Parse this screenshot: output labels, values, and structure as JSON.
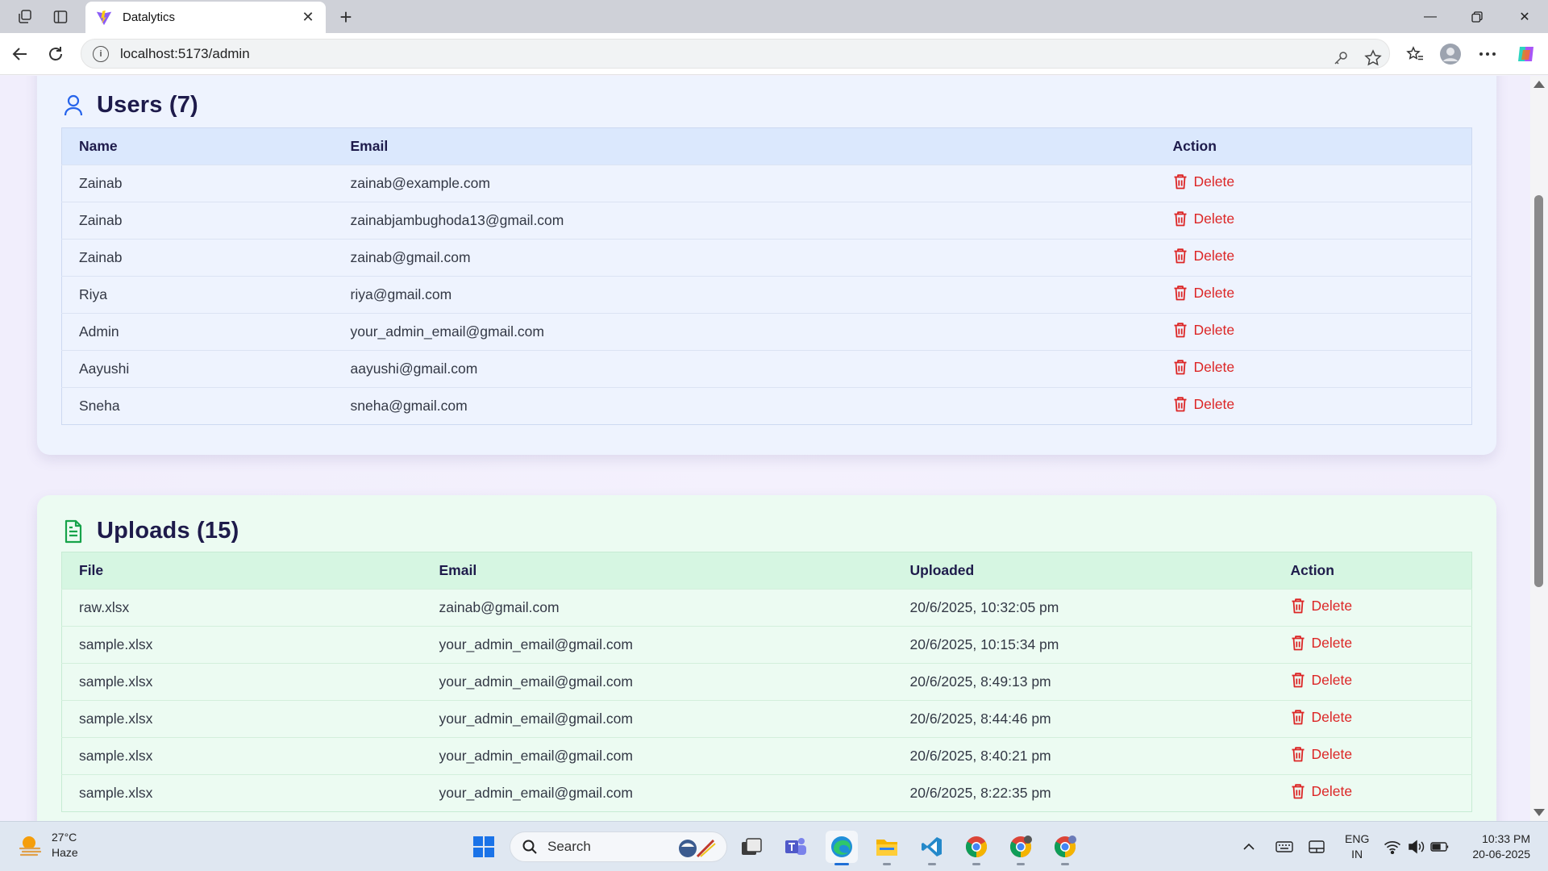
{
  "browser": {
    "tab_title": "Datalytics",
    "url": "localhost:5173/admin"
  },
  "users_card": {
    "title": "Users (7)",
    "columns": [
      "Name",
      "Email",
      "Action"
    ],
    "rows": [
      {
        "name": "Zainab",
        "email": "zainab@example.com",
        "action": "Delete"
      },
      {
        "name": "Zainab",
        "email": "zainabjambughoda13@gmail.com",
        "action": "Delete"
      },
      {
        "name": "Zainab",
        "email": "zainab@gmail.com",
        "action": "Delete"
      },
      {
        "name": "Riya",
        "email": "riya@gmail.com",
        "action": "Delete"
      },
      {
        "name": "Admin",
        "email": "your_admin_email@gmail.com",
        "action": "Delete"
      },
      {
        "name": "Aayushi",
        "email": "aayushi@gmail.com",
        "action": "Delete"
      },
      {
        "name": "Sneha",
        "email": "sneha@gmail.com",
        "action": "Delete"
      }
    ]
  },
  "uploads_card": {
    "title": "Uploads (15)",
    "columns": [
      "File",
      "Email",
      "Uploaded",
      "Action"
    ],
    "rows": [
      {
        "file": "raw.xlsx",
        "email": "zainab@gmail.com",
        "uploaded": "20/6/2025, 10:32:05 pm",
        "action": "Delete"
      },
      {
        "file": "sample.xlsx",
        "email": "your_admin_email@gmail.com",
        "uploaded": "20/6/2025, 10:15:34 pm",
        "action": "Delete"
      },
      {
        "file": "sample.xlsx",
        "email": "your_admin_email@gmail.com",
        "uploaded": "20/6/2025, 8:49:13 pm",
        "action": "Delete"
      },
      {
        "file": "sample.xlsx",
        "email": "your_admin_email@gmail.com",
        "uploaded": "20/6/2025, 8:44:46 pm",
        "action": "Delete"
      },
      {
        "file": "sample.xlsx",
        "email": "your_admin_email@gmail.com",
        "uploaded": "20/6/2025, 8:40:21 pm",
        "action": "Delete"
      },
      {
        "file": "sample.xlsx",
        "email": "your_admin_email@gmail.com",
        "uploaded": "20/6/2025, 8:22:35 pm",
        "action": "Delete"
      }
    ]
  },
  "taskbar": {
    "weather_temp": "27°C",
    "weather_desc": "Haze",
    "search_label": "Search",
    "lang_top": "ENG",
    "lang_bottom": "IN",
    "time": "10:33 PM",
    "date": "20-06-2025"
  },
  "colors": {
    "accent_blue": "#2563eb",
    "accent_green": "#16a34a",
    "delete_red": "#dc2626",
    "heading": "#1e1b4b"
  }
}
